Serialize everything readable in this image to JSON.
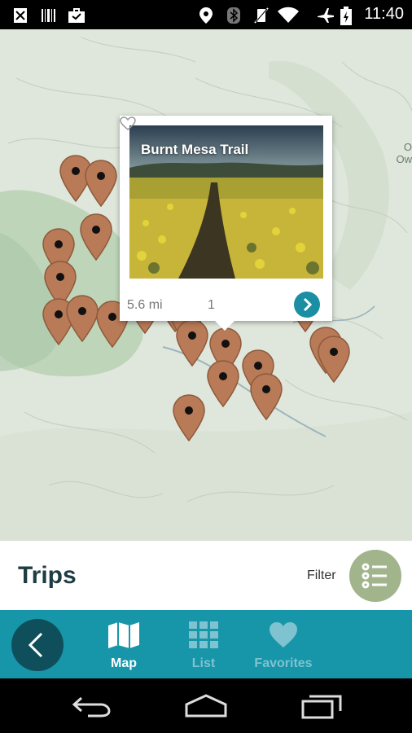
{
  "status_bar": {
    "time": "11:40"
  },
  "map": {
    "edge_labels": [
      "O",
      "Ow"
    ]
  },
  "popup": {
    "title": "Burnt Mesa Trail",
    "distance": "5.6 mi",
    "likes": "1"
  },
  "trips_panel": {
    "title": "Trips",
    "filter_label": "Filter"
  },
  "bottom_nav": {
    "tabs": [
      {
        "label": "Map",
        "active": true
      },
      {
        "label": "List",
        "active": false
      },
      {
        "label": "Favorites",
        "active": false
      }
    ]
  },
  "colors": {
    "accent": "#1795a9",
    "back_button": "#0f4f5b",
    "pin": "#b87a57",
    "filter_button": "#a1b48c",
    "title": "#1e3c43"
  },
  "icons": {
    "status": [
      "notification-icon",
      "barcode-icon",
      "briefcase-icon",
      "location-icon",
      "bluetooth-icon",
      "vibrate-off-icon",
      "wifi-icon",
      "airplane-icon",
      "battery-icon"
    ],
    "popup": [
      "heart-icon",
      "chevron-right-icon"
    ],
    "panel": [
      "list-icon"
    ],
    "nav": [
      "back-arrow-icon",
      "map-icon",
      "grid-icon",
      "heart-icon"
    ],
    "system": [
      "system-back-icon",
      "system-home-icon",
      "system-recents-icon"
    ]
  }
}
